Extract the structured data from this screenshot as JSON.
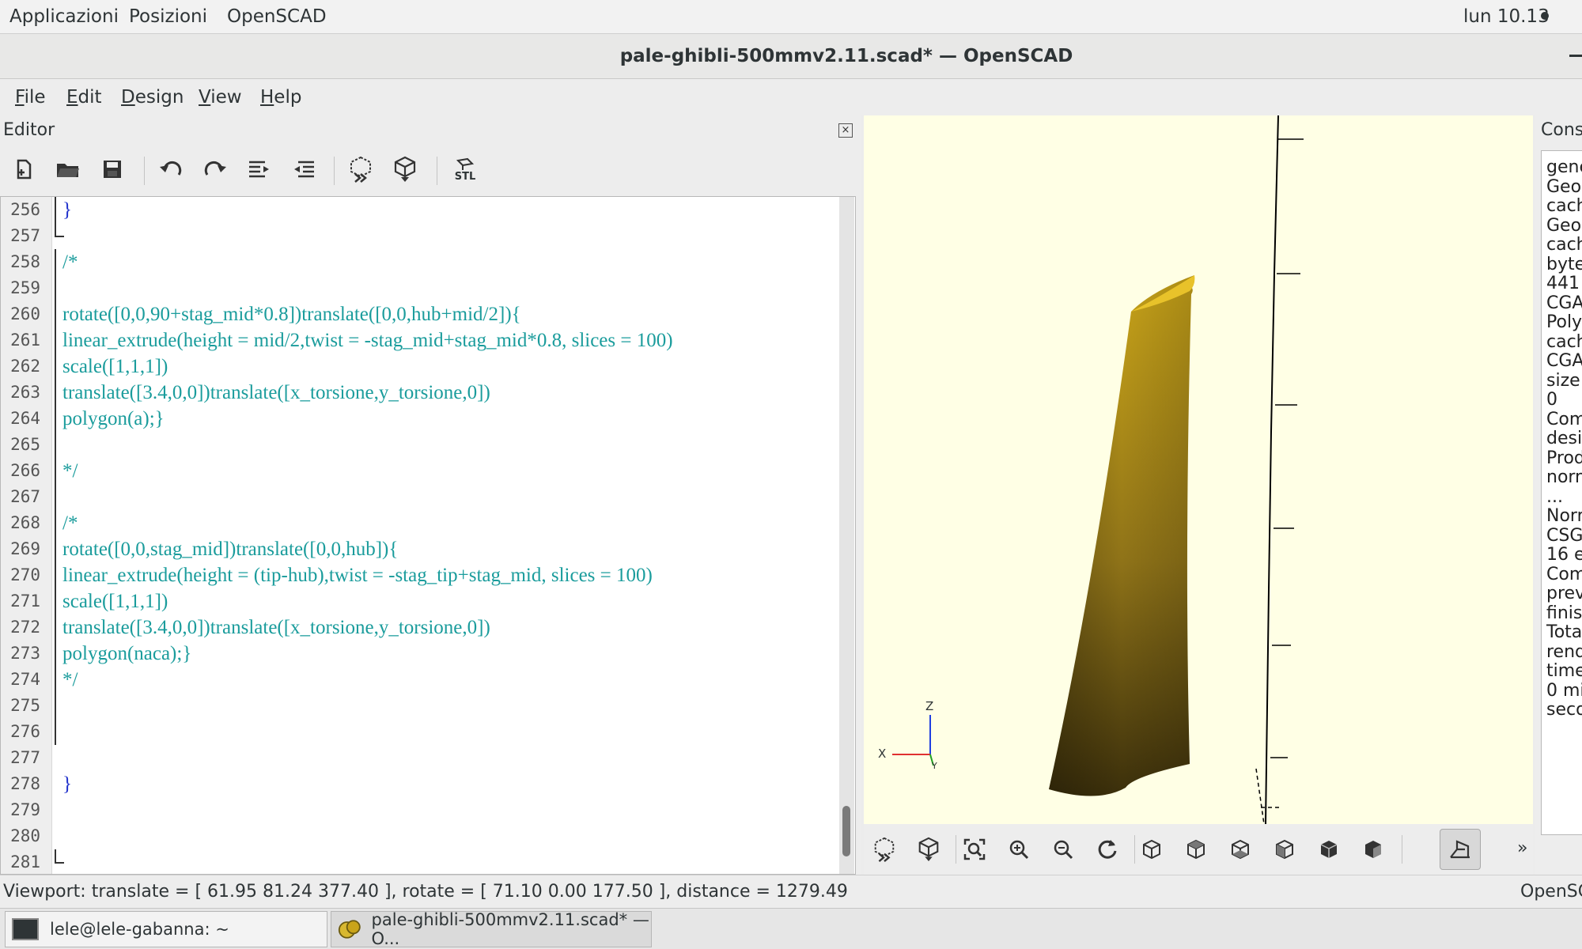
{
  "top_panel": {
    "applications": "Applicazioni",
    "places": "Posizioni",
    "app_name": "OpenSCAD",
    "clock": "lun 10.13"
  },
  "window": {
    "title": "pale-ghibli-500mmv2.11.scad* — OpenSCAD"
  },
  "menubar": {
    "items": [
      {
        "first": "F",
        "rest": "ile"
      },
      {
        "first": "E",
        "rest": "dit"
      },
      {
        "first": "D",
        "rest": "esign"
      },
      {
        "first": "V",
        "rest": "iew"
      },
      {
        "first": "H",
        "rest": "elp"
      }
    ]
  },
  "editor": {
    "title": "Editor",
    "toolbar_icons": [
      "new-file-icon",
      "open-file-icon",
      "save-icon",
      "undo-icon",
      "redo-icon",
      "indent-icon",
      "unindent-icon",
      "preview-icon",
      "render-icon",
      "export-stl-icon"
    ],
    "stl_label": "STL",
    "lines": [
      {
        "n": "256",
        "text": "}",
        "brace": true
      },
      {
        "n": "257",
        "text": ""
      },
      {
        "n": "258",
        "text": "/*"
      },
      {
        "n": "259",
        "text": ""
      },
      {
        "n": "260",
        "text": "rotate([0,0,90+stag_mid*0.8])translate([0,0,hub+mid/2]){"
      },
      {
        "n": "261",
        "text": "linear_extrude(height = mid/2,twist = -stag_mid+stag_mid*0.8, slices = 100)"
      },
      {
        "n": "262",
        "text": "scale([1,1,1])"
      },
      {
        "n": "263",
        "text": "translate([3.4,0,0])translate([x_torsione,y_torsione,0])"
      },
      {
        "n": "264",
        "text": "polygon(a);}"
      },
      {
        "n": "265",
        "text": ""
      },
      {
        "n": "266",
        "text": "*/"
      },
      {
        "n": "267",
        "text": ""
      },
      {
        "n": "268",
        "text": "/*"
      },
      {
        "n": "269",
        "text": "rotate([0,0,stag_mid])translate([0,0,hub]){"
      },
      {
        "n": "270",
        "text": "linear_extrude(height = (tip-hub),twist = -stag_tip+stag_mid, slices = 100)"
      },
      {
        "n": "271",
        "text": "scale([1,1,1])"
      },
      {
        "n": "272",
        "text": "translate([3.4,0,0])translate([x_torsione,y_torsione,0])"
      },
      {
        "n": "273",
        "text": "polygon(naca);}"
      },
      {
        "n": "274",
        "text": "*/"
      },
      {
        "n": "275",
        "text": ""
      },
      {
        "n": "276",
        "text": ""
      },
      {
        "n": "277",
        "text": ""
      },
      {
        "n": "278",
        "text": "}",
        "brace": true
      },
      {
        "n": "279",
        "text": ""
      },
      {
        "n": "280",
        "text": ""
      },
      {
        "n": "281",
        "text": ""
      }
    ]
  },
  "viewport": {
    "axis_labels": {
      "z": "Z",
      "x": "X",
      "y": "Y"
    },
    "model_color": "#c9a419",
    "background": "#ffffe5"
  },
  "view_toolbar": {
    "icons": [
      "preview-icon",
      "render-icon",
      "view-all-icon",
      "zoom-in-icon",
      "zoom-out-icon",
      "reset-view-icon",
      "view-right-icon",
      "view-top-icon",
      "view-bottom-icon",
      "view-left-icon",
      "view-front-icon",
      "view-back-icon",
      "perspective-icon"
    ],
    "overflow": "»"
  },
  "console": {
    "title": "Cons",
    "lines": [
      "gene",
      "Geor",
      "cach",
      "Geor",
      "cach",
      "byte",
      "441!",
      "CGA",
      "Polyl",
      "cach",
      "CGA",
      "size",
      "0",
      "Com",
      "desi",
      "Prod",
      "norn",
      "...",
      "Norr",
      "CSG",
      "16 e",
      "Com",
      "prev",
      "finisl",
      "Tota",
      "rend",
      "time",
      "0 mi",
      "seco"
    ]
  },
  "status_bar": {
    "text": "Viewport: translate = [ 61.95 81.24 377.40 ], rotate = [ 71.10 0.00 177.50 ], distance = 1279.49",
    "right": "OpenSC"
  },
  "taskbar": {
    "items": [
      {
        "label": "lele@lele-gabanna: ~"
      },
      {
        "label": "pale-ghibli-500mmv2.11.scad* — O..."
      }
    ]
  }
}
